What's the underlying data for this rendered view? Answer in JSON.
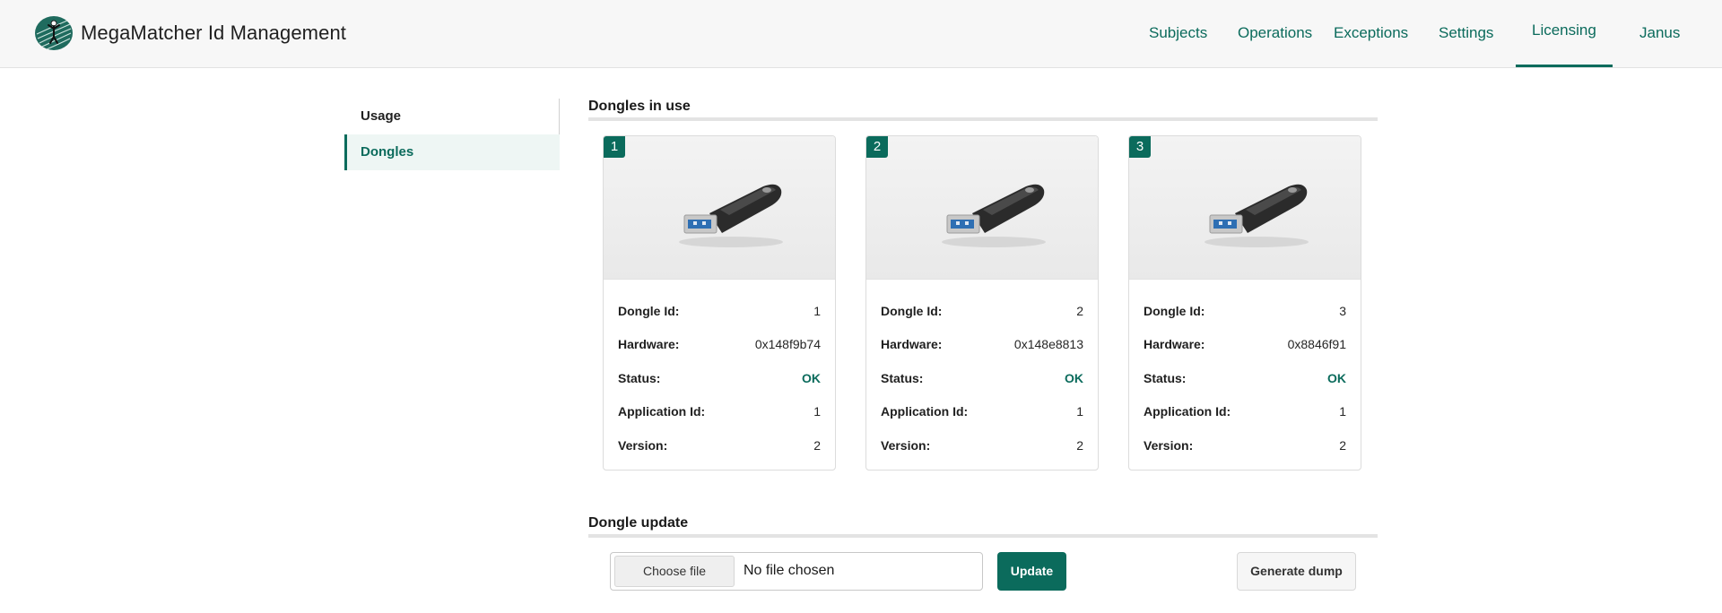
{
  "header": {
    "app_title": "MegaMatcher Id Management",
    "logo_icon": "megamatcher-logo-icon",
    "nav": [
      {
        "label": "Subjects"
      },
      {
        "label": "Operations"
      },
      {
        "label": "Exceptions"
      },
      {
        "label": "Settings"
      },
      {
        "label": "Licensing",
        "active": true
      },
      {
        "label": "Janus"
      }
    ]
  },
  "sidebar": {
    "items": [
      {
        "label": "Usage"
      },
      {
        "label": "Dongles",
        "active": true
      }
    ]
  },
  "dongles_section": {
    "title": "Dongles in use",
    "labels": {
      "dongle_id": "Dongle Id:",
      "hardware": "Hardware:",
      "status": "Status:",
      "application_id": "Application Id:",
      "version": "Version:"
    },
    "cards": [
      {
        "badge": "1",
        "image_icon": "usb-dongle-image",
        "dongle_id": "1",
        "hardware": "0x148f9b74",
        "status": "OK",
        "application_id": "1",
        "version": "2"
      },
      {
        "badge": "2",
        "image_icon": "usb-dongle-image",
        "dongle_id": "2",
        "hardware": "0x148e8813",
        "status": "OK",
        "application_id": "1",
        "version": "2"
      },
      {
        "badge": "3",
        "image_icon": "usb-dongle-image",
        "dongle_id": "3",
        "hardware": "0x8846f91",
        "status": "OK",
        "application_id": "1",
        "version": "2"
      }
    ]
  },
  "update_section": {
    "title": "Dongle update",
    "choose_file_label": "Choose file",
    "file_status": "No file chosen",
    "update_label": "Update",
    "dump_label": "Generate dump"
  },
  "colors": {
    "accent": "#0b6b5c",
    "status_ok": "#0b6b5c",
    "header_bg": "#f7f7f7"
  }
}
